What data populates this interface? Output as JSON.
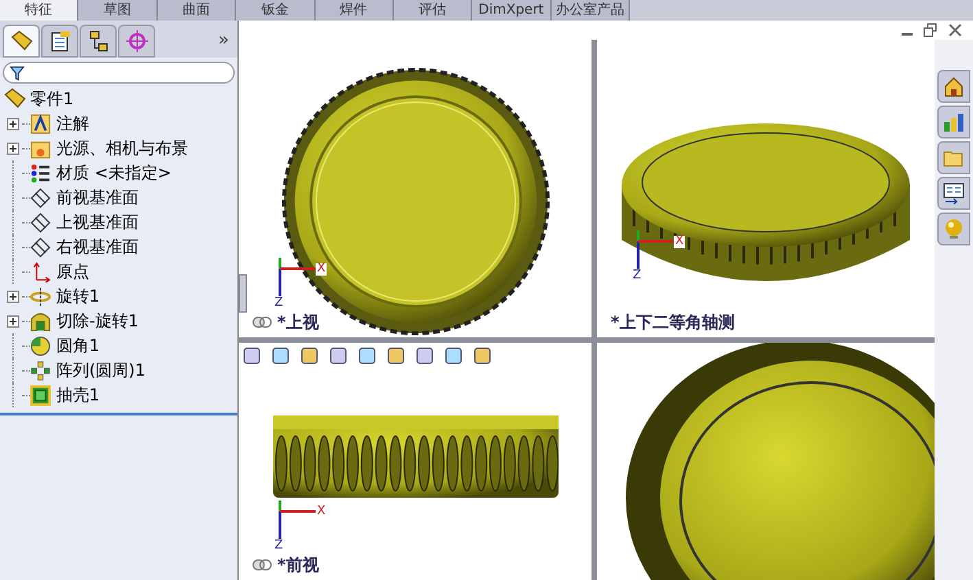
{
  "top_tabs": [
    {
      "label": "特征",
      "selected": true
    },
    {
      "label": "草图",
      "selected": false
    },
    {
      "label": "曲面",
      "selected": false
    },
    {
      "label": "钣金",
      "selected": false
    },
    {
      "label": "焊件",
      "selected": false
    },
    {
      "label": "评估",
      "selected": false
    },
    {
      "label": "DimXpert",
      "selected": false
    },
    {
      "label": "办公室产品",
      "selected": false
    }
  ],
  "panel_tabs": [
    {
      "kind": "tree",
      "selected": true
    },
    {
      "kind": "property",
      "selected": false
    },
    {
      "kind": "config",
      "selected": false
    },
    {
      "kind": "target",
      "selected": false
    }
  ],
  "panel_more": "»",
  "tree": {
    "root": "零件1",
    "items": [
      {
        "label": "注解",
        "kind": "annotation",
        "expandable": true
      },
      {
        "label": "光源、相机与布景",
        "kind": "lights",
        "expandable": true
      },
      {
        "label": "材质 <未指定>",
        "kind": "material",
        "expandable": false
      },
      {
        "label": "前视基准面",
        "kind": "plane",
        "expandable": false
      },
      {
        "label": "上视基准面",
        "kind": "plane",
        "expandable": false
      },
      {
        "label": "右视基准面",
        "kind": "plane",
        "expandable": false
      },
      {
        "label": "原点",
        "kind": "origin",
        "expandable": false
      },
      {
        "label": "旋转1",
        "kind": "revolve",
        "expandable": true
      },
      {
        "label": "切除-旋转1",
        "kind": "cut",
        "expandable": true
      },
      {
        "label": "圆角1",
        "kind": "fillet",
        "expandable": false
      },
      {
        "label": "阵列(圆周)1",
        "kind": "pattern",
        "expandable": false
      },
      {
        "label": "抽壳1",
        "kind": "shell",
        "expandable": false
      }
    ]
  },
  "viewports": [
    {
      "label": "*上视",
      "linked": true,
      "kind": "top",
      "triad": {
        "x": "X",
        "z": "Z"
      }
    },
    {
      "label": "*上下二等角轴测",
      "linked": false,
      "kind": "iso",
      "triad": {
        "x": "X",
        "z": "Z"
      }
    },
    {
      "label": "*前视",
      "linked": true,
      "kind": "front",
      "triad": {
        "x": "X",
        "z": "Z"
      }
    },
    {
      "kind": "bottom",
      "linked": false
    }
  ],
  "task_pane": [
    {
      "kind": "home"
    },
    {
      "kind": "chart"
    },
    {
      "kind": "folder"
    },
    {
      "kind": "palette"
    },
    {
      "kind": "ball"
    }
  ]
}
